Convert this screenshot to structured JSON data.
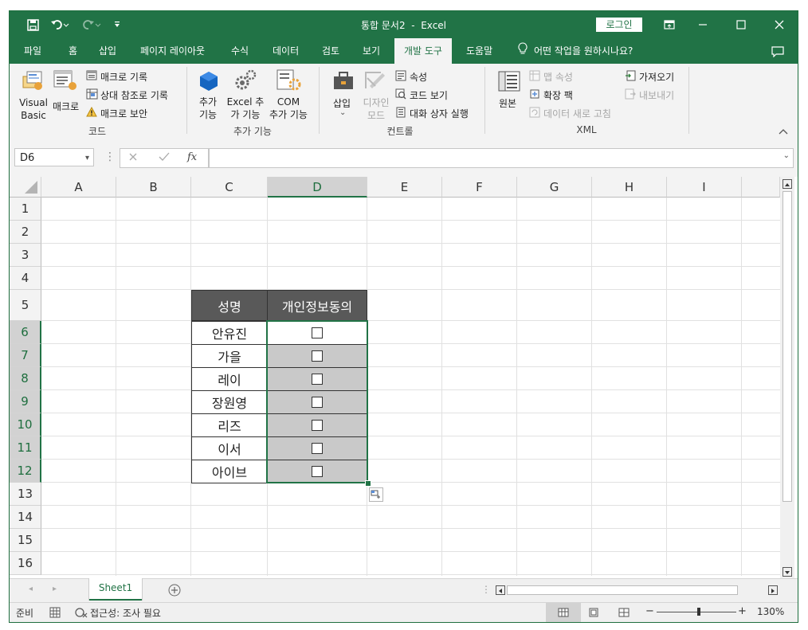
{
  "title": {
    "doc": "통합 문서2",
    "sep": "-",
    "app": "Excel",
    "login": "로그인"
  },
  "tabs": [
    "파일",
    "홈",
    "삽입",
    "페이지 레이아웃",
    "수식",
    "데이터",
    "검토",
    "보기",
    "개발 도구",
    "도움말"
  ],
  "active_tab": "개발 도구",
  "tellme": "어떤 작업을 원하시나요?",
  "ribbon": {
    "code": {
      "label": "코드",
      "visual_basic_1": "Visual",
      "visual_basic_2": "Basic",
      "macro": "매크로",
      "record_macro": "매크로 기록",
      "relative_ref": "상대 참조로 기록",
      "macro_security": "매크로 보안"
    },
    "addins": {
      "label": "추가 기능",
      "addins_1": "추가",
      "addins_2": "기능",
      "excel_addins_1": "Excel 추",
      "excel_addins_2": "가 기능",
      "com_addins_1": "COM",
      "com_addins_2": "추가 기능"
    },
    "controls": {
      "label": "컨트롤",
      "insert": "삽입",
      "design_mode_1": "디자인",
      "design_mode_2": "모드",
      "properties": "속성",
      "view_code": "코드 보기",
      "run_dialog": "대화 상자 실행"
    },
    "xml": {
      "label": "XML",
      "source": "원본",
      "map_props": "맵 속성",
      "expansion_packs": "확장 팩",
      "refresh_data": "데이터 새로 고침",
      "import": "가져오기",
      "export": "내보내기"
    }
  },
  "formula_bar": {
    "name_box": "D6",
    "fx": "fx",
    "formula": ""
  },
  "columns": [
    "A",
    "B",
    "C",
    "D",
    "E",
    "F",
    "G",
    "H",
    "I"
  ],
  "rows": [
    "1",
    "2",
    "3",
    "4",
    "5",
    "6",
    "7",
    "8",
    "9",
    "10",
    "11",
    "12",
    "13",
    "14",
    "15",
    "16"
  ],
  "selected_cell": "D6",
  "table": {
    "header_name": "성명",
    "header_consent": "개인정보동의",
    "names": [
      "안유진",
      "가을",
      "레이",
      "장원영",
      "리즈",
      "이서",
      "아이브"
    ]
  },
  "sheets": [
    "Sheet1"
  ],
  "status": {
    "ready": "준비",
    "accessibility": "접근성: 조사 필요",
    "zoom": "130%",
    "zoom_minus": "−",
    "zoom_plus": "+"
  },
  "colors": {
    "excel_green": "#217346",
    "header_fill": "#595959",
    "checkbox_fill": "#c9c9c9"
  }
}
